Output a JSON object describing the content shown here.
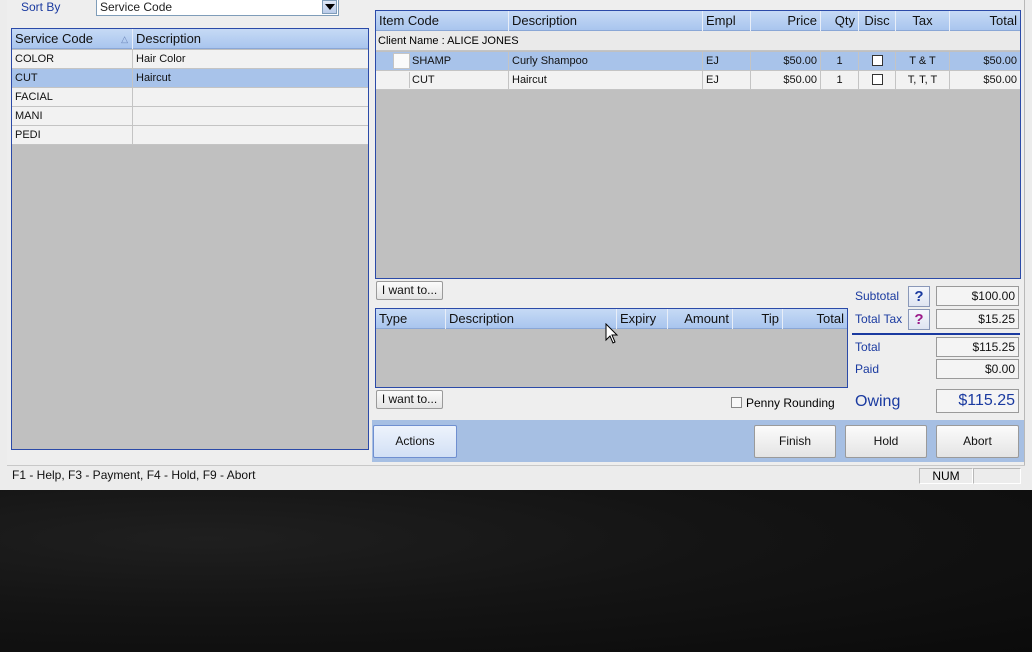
{
  "sort_by": {
    "label": "Sort By",
    "value": "Service Code"
  },
  "services_grid": {
    "columns": [
      "Service Code",
      "Description"
    ],
    "rows": [
      {
        "code": "COLOR",
        "description": "Hair Color",
        "selected": false
      },
      {
        "code": "CUT",
        "description": "Haircut",
        "selected": true
      },
      {
        "code": "FACIAL",
        "description": "",
        "selected": false
      },
      {
        "code": "MANI",
        "description": "",
        "selected": false
      },
      {
        "code": "PEDI",
        "description": "",
        "selected": false
      }
    ]
  },
  "ticket_grid": {
    "columns": [
      "Item Code",
      "Description",
      "Empl",
      "Price",
      "Qty",
      "Disc",
      "Tax",
      "Total"
    ],
    "client_label": "Client Name : ALICE JONES",
    "rows": [
      {
        "item_code": "SHAMP",
        "description": "Curly Shampoo",
        "empl": "EJ",
        "price": "$50.00",
        "qty": "1",
        "disc": false,
        "tax": "T & T",
        "total": "$50.00",
        "selected": true
      },
      {
        "item_code": "CUT",
        "description": "Haircut",
        "empl": "EJ",
        "price": "$50.00",
        "qty": "1",
        "disc": false,
        "tax": "T, T, T",
        "total": "$50.00",
        "selected": false
      }
    ]
  },
  "i_want_to_label": "I want to...",
  "payments_grid": {
    "columns": [
      "Type",
      "Description",
      "Expiry",
      "Amount",
      "Tip",
      "Total"
    ]
  },
  "totals": {
    "subtotal_label": "Subtotal",
    "subtotal": "$100.00",
    "total_tax_label": "Total Tax",
    "total_tax": "$15.25",
    "help_symbol": "?",
    "total_label": "Total",
    "total": "$115.25",
    "paid_label": "Paid",
    "paid": "$0.00",
    "owing_label": "Owing",
    "owing": "$115.25"
  },
  "penny_rounding_label": "Penny Rounding",
  "buttons": {
    "actions": "Actions",
    "finish": "Finish",
    "hold": "Hold",
    "abort": "Abort"
  },
  "status": {
    "shortcuts": "F1 - Help, F3 - Payment, F4 - Hold, F9 - Abort",
    "num": "NUM"
  },
  "colors": {
    "accent": "#1a3aa0",
    "header": "#a9c5ee",
    "selection": "#a8c3ea",
    "action_bar": "#a6bfe3"
  },
  "icons": [
    "dropdown-arrow-icon",
    "sort-ascending-icon",
    "checkbox-icon",
    "help-question-icon",
    "mouse-pointer-icon"
  ]
}
